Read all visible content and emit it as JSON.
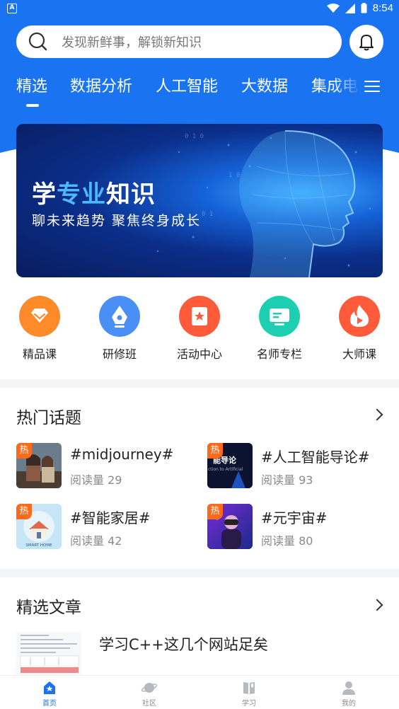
{
  "status_bar": {
    "time": "8:54",
    "left_icon": "A"
  },
  "search": {
    "placeholder": "发现新鲜事，解锁新知识"
  },
  "tabs": [
    "精选",
    "数据分析",
    "人工智能",
    "大数据",
    "集成电"
  ],
  "banner": {
    "title_part1": "学",
    "title_part2": "专业",
    "title_part3": "知识",
    "subtitle": "聊未来趋势  聚焦终身成长"
  },
  "quick_links": [
    {
      "label": "精品课",
      "icon": "diamond-icon",
      "color": "#ff8a2a"
    },
    {
      "label": "研修班",
      "icon": "pen-nib-icon",
      "color": "#4a8ff5"
    },
    {
      "label": "活动中心",
      "icon": "calendar-star-icon",
      "color": "#ff5a3a"
    },
    {
      "label": "名师专栏",
      "icon": "monitor-icon",
      "color": "#1ccfb0"
    },
    {
      "label": "大师课",
      "icon": "flame-play-icon",
      "color": "#ff5a3a"
    }
  ],
  "hot_topics": {
    "title": "热门话题",
    "hot_label": "热",
    "items": [
      {
        "title": "#midjourney#",
        "reads": "阅读量 29"
      },
      {
        "title": "#人工智能导论#",
        "reads": "阅读量 93"
      },
      {
        "title": "#智能家居#",
        "reads": "阅读量 42"
      },
      {
        "title": "#元宇宙#",
        "reads": "阅读量 80"
      }
    ],
    "thumb_texts": {
      "ai_intro": "能导论",
      "ai_intro_sub": "ction to Artificial",
      "smart_home": "SMART HOME"
    }
  },
  "articles": {
    "title": "精选文章",
    "items": [
      {
        "title": "学习C++这几个网站足矣"
      }
    ]
  },
  "bottom_nav": [
    {
      "label": "首页",
      "active": true
    },
    {
      "label": "社区",
      "active": false
    },
    {
      "label": "学习",
      "active": false
    },
    {
      "label": "我的",
      "active": false
    }
  ],
  "colors": {
    "primary": "#1a73f0",
    "hot": "#ff6a1a"
  }
}
